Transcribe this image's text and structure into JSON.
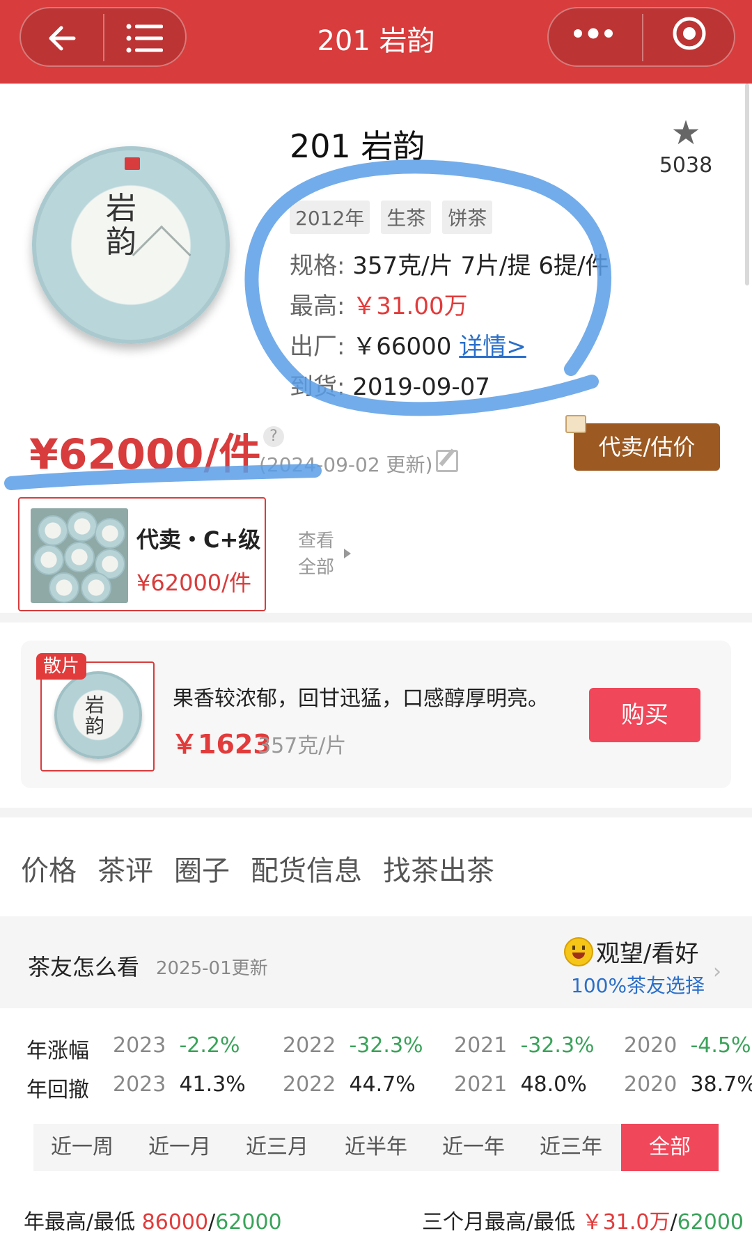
{
  "header": {
    "title": "201 岩韵",
    "back_icon": "arrow-left-icon",
    "menu_icon": "list-icon",
    "more_icon": "ellipsis-icon",
    "target_icon": "record-icon"
  },
  "product": {
    "title": "201 岩韵",
    "image_text": "岩韵",
    "fav_count": "5038",
    "tags": [
      "2012年",
      "生茶",
      "饼茶"
    ],
    "spec": {
      "label": "规格:",
      "value": "357克/片 7片/提 6提/件"
    },
    "highest": {
      "label": "最高:",
      "value": "￥31.00万"
    },
    "factory": {
      "label": "出厂:",
      "value": "￥66000",
      "link": "详情>"
    },
    "arrival": {
      "label": "到货:",
      "value": "2019-09-07"
    },
    "price": "¥62000/件",
    "help": "?",
    "updated": "(2024-09-02 更新)",
    "consign_button": "代卖/估价"
  },
  "consignment": {
    "title": "代卖・C+级",
    "price": "¥62000/件",
    "view_all": "查看全部"
  },
  "loose": {
    "badge": "散片",
    "image_text": "岩韵",
    "desc": "果香较浓郁，回甘迅猛，口感醇厚明亮。",
    "price": "￥1623",
    "unit": "357克/片",
    "buy": "购买"
  },
  "tabs": [
    "价格",
    "茶评",
    "圈子",
    "配货信息",
    "找茶出茶"
  ],
  "opinion": {
    "title": "茶友怎么看",
    "date": "2025-01更新",
    "stance": "观望/看好",
    "percent": "100%茶友选择"
  },
  "stats": {
    "growth": {
      "label": "年涨幅",
      "items": [
        {
          "year": "2023",
          "value": "-2.2%"
        },
        {
          "year": "2022",
          "value": "-32.3%"
        },
        {
          "year": "2021",
          "value": "-32.3%"
        },
        {
          "year": "2020",
          "value": "-4.5%"
        }
      ]
    },
    "drawdown": {
      "label": "年回撤",
      "items": [
        {
          "year": "2023",
          "value": "41.3%"
        },
        {
          "year": "2022",
          "value": "44.7%"
        },
        {
          "year": "2021",
          "value": "48.0%"
        },
        {
          "year": "2020",
          "value": "38.7%"
        }
      ]
    }
  },
  "periods": [
    "近一周",
    "近一月",
    "近三月",
    "近半年",
    "近一年",
    "近三年",
    "全部"
  ],
  "active_period": "全部",
  "bottom": {
    "year_label": "年最高/最低 ",
    "year_high": "86000",
    "year_sep": "/",
    "year_low": "62000",
    "three_label": "三个月最高/最低 ",
    "three_high": "￥31.0万",
    "three_sep": "/",
    "three_low": "62000"
  },
  "colors": {
    "brand_red": "#d83c3c",
    "accent_red": "#f0475a",
    "green": "#3aa35a",
    "link_blue": "#2a6fc9",
    "annotation_blue": "#5b9de6",
    "consign_brown": "#9c5a22"
  }
}
